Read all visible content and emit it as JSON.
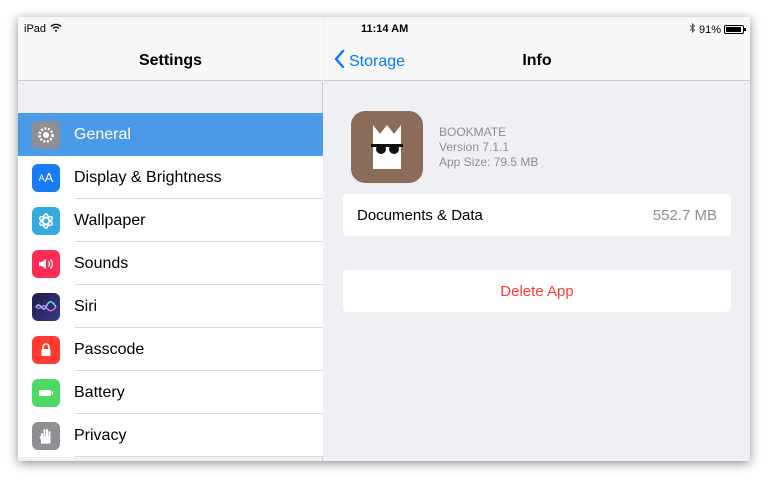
{
  "status_bar": {
    "device": "iPad",
    "time": "11:14 AM",
    "battery": "91%",
    "battery_level": 0.91
  },
  "master": {
    "title": "Settings",
    "items": [
      {
        "label": "General",
        "icon": "gear-icon",
        "color": "#8e8e93",
        "selected": true
      },
      {
        "label": "Display & Brightness",
        "icon": "display-icon",
        "color": "#1a7cf5"
      },
      {
        "label": "Wallpaper",
        "icon": "wallpaper-icon",
        "color": "#35aadc"
      },
      {
        "label": "Sounds",
        "icon": "speaker-icon",
        "color": "#ff2d55"
      },
      {
        "label": "Siri",
        "icon": "siri-icon",
        "color": "#2a2a6b"
      },
      {
        "label": "Passcode",
        "icon": "lock-icon",
        "color": "#ff3b30"
      },
      {
        "label": "Battery",
        "icon": "battery-icon",
        "color": "#4cd964"
      },
      {
        "label": "Privacy",
        "icon": "hand-icon",
        "color": "#8e8e93"
      }
    ]
  },
  "detail": {
    "back_label": "Storage",
    "title": "Info",
    "app": {
      "name": "BOOKMATE",
      "version": "Version 7.1.1",
      "size": "App Size: 79.5 MB",
      "icon_color": "#8b6c58"
    },
    "documents_label": "Documents & Data",
    "documents_value": "552.7 MB",
    "delete_label": "Delete App"
  }
}
